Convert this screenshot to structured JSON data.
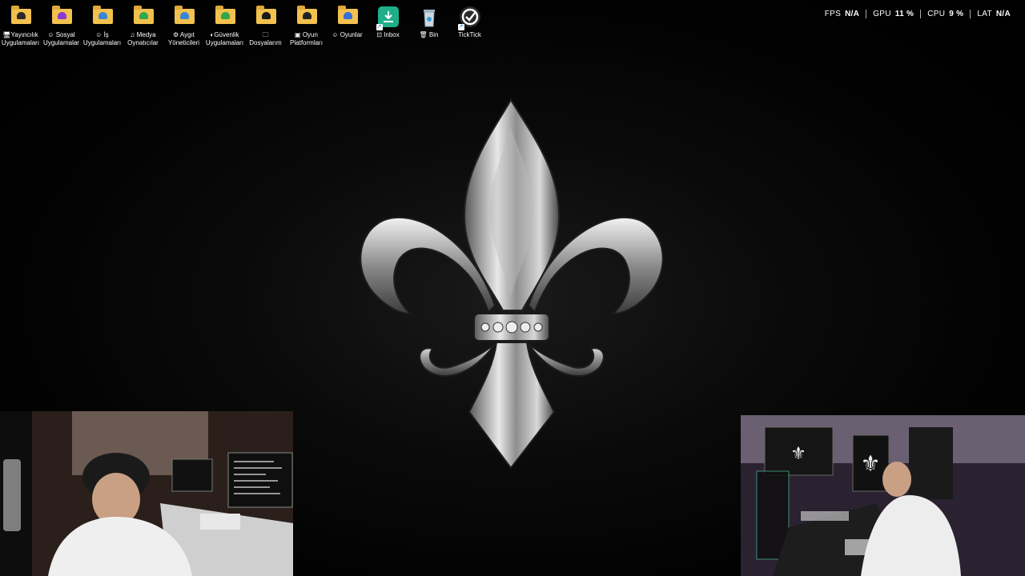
{
  "desktop": {
    "icons": [
      {
        "name": "yayincilik-folder",
        "label": "🖥Yayıncılık\nUygulamaları",
        "kind": "folder",
        "badge_color": "#2b2b2b"
      },
      {
        "name": "sosyal-folder",
        "label": "☺ Sosyal\nUygulamalar",
        "kind": "folder",
        "badge_color": "#8a3bd1"
      },
      {
        "name": "is-folder",
        "label": "☺ İş\nUygulamaları",
        "kind": "folder",
        "badge_color": "#3a86d6"
      },
      {
        "name": "medya-folder",
        "label": "♫ Medya\nOynatıcılar",
        "kind": "folder",
        "badge_color": "#2fa84f"
      },
      {
        "name": "aygit-folder",
        "label": "⚙ Aygıt\nYöneticileri",
        "kind": "folder",
        "badge_color": "#3a86d6"
      },
      {
        "name": "guvenlik-folder",
        "label": "◐Güvenlik\nUygulamaları",
        "kind": "folder",
        "badge_color": "#2fa84f"
      },
      {
        "name": "dosyalarim-folder",
        "label": "🗀\nDosyalarım",
        "kind": "folder",
        "badge_color": "#1a1a1a"
      },
      {
        "name": "oyun-platformlari-folder",
        "label": "▣ Oyun\nPlatformları",
        "kind": "folder",
        "badge_color": "#222"
      },
      {
        "name": "oyunlar-folder",
        "label": "☺ Oyunlar",
        "kind": "folder",
        "badge_color": "#3a6fd6"
      },
      {
        "name": "inbox-shortcut",
        "label": "⊡ Inbox",
        "kind": "app",
        "color": "#1fae8a"
      },
      {
        "name": "bin-icon",
        "label": "🗑 Bin",
        "kind": "bin",
        "color": "#cfd8e3"
      },
      {
        "name": "ticktick-shortcut",
        "label": "TickTick",
        "kind": "app",
        "color": "#2a2a2a"
      }
    ]
  },
  "perf_overlay": {
    "items": [
      {
        "key": "FPS",
        "value": "N/A"
      },
      {
        "key": "GPU",
        "value": "11 %"
      },
      {
        "key": "CPU",
        "value": "9 %"
      },
      {
        "key": "LAT",
        "value": "N/A"
      }
    ]
  }
}
